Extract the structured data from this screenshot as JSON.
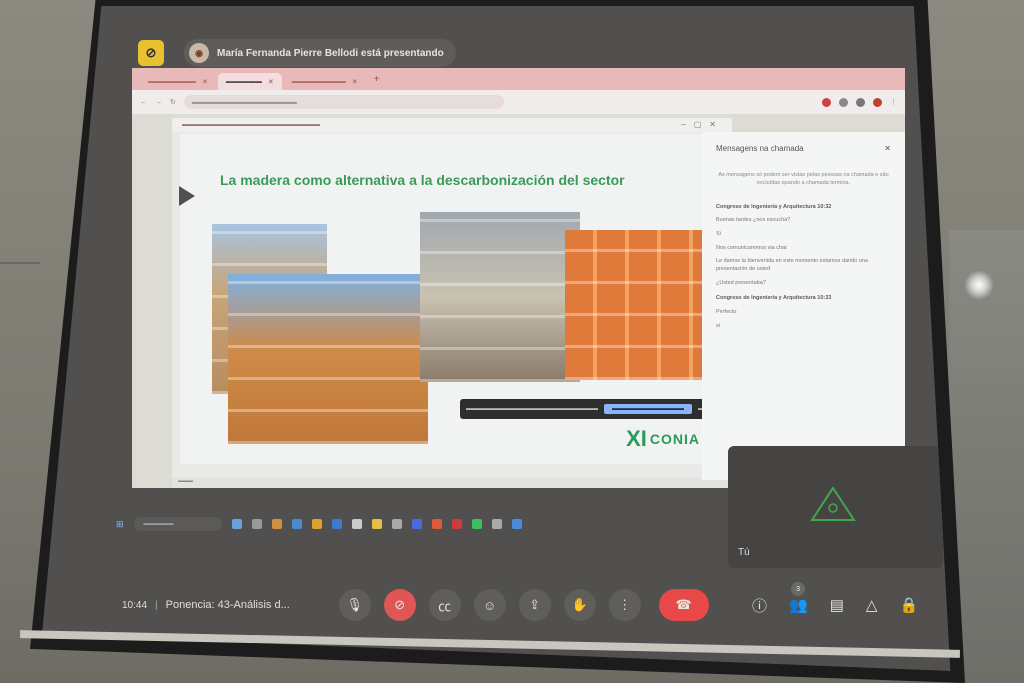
{
  "meet": {
    "presenting": "María Fernanda Pierre Bellodi está presentando"
  },
  "chat": {
    "title": "Mensagens na chamada",
    "close": "✕",
    "info": "As mensagens só podem ser vistas pelas pessoas na chamada e são excluídas quando a chamada termina.",
    "messages": [
      {
        "sender": "Congreso de Ingeniería y Arquitectura",
        "time": "10:32"
      },
      {
        "text": "Buenas tardes ¿nos escucha?"
      },
      {
        "text": "Si"
      },
      {
        "text": "Nos comunicaremos via chat"
      },
      {
        "text": "Le damos la bienvenida en este momento estamos dando una presentación de usted"
      },
      {
        "text": "¿Usted presentaba?"
      },
      {
        "sender": "Congreso de Ingeniería y Arquitectura",
        "time": "10:33"
      },
      {
        "text": "Perfecto"
      },
      {
        "text": "si"
      }
    ]
  },
  "slide": {
    "title": "La madera como alternativa a la descarbonización del sector",
    "logo_xi": "XI",
    "logo_conia": "CONIA"
  },
  "self_tile": {
    "label": "Tú"
  },
  "bottom_bar": {
    "time": "10:44",
    "separator": "|",
    "meeting_name": "Ponencia: 43-Análisis d...",
    "participants_count": "3"
  },
  "icons": {
    "mic": "mic-icon",
    "camera_off": "camera-off-icon",
    "captions": "captions-icon",
    "emoji": "emoji-icon",
    "present": "present-icon",
    "hand": "raise-hand-icon",
    "more": "more-options-icon",
    "hangup": "hangup-icon",
    "info": "info-icon",
    "people": "people-icon",
    "chat": "chat-icon",
    "activities": "activities-icon",
    "lock": "host-controls-icon"
  },
  "colors": {
    "slide_title": "#3a9a58",
    "hangup": "#e84848",
    "camera_off": "#e05555"
  }
}
